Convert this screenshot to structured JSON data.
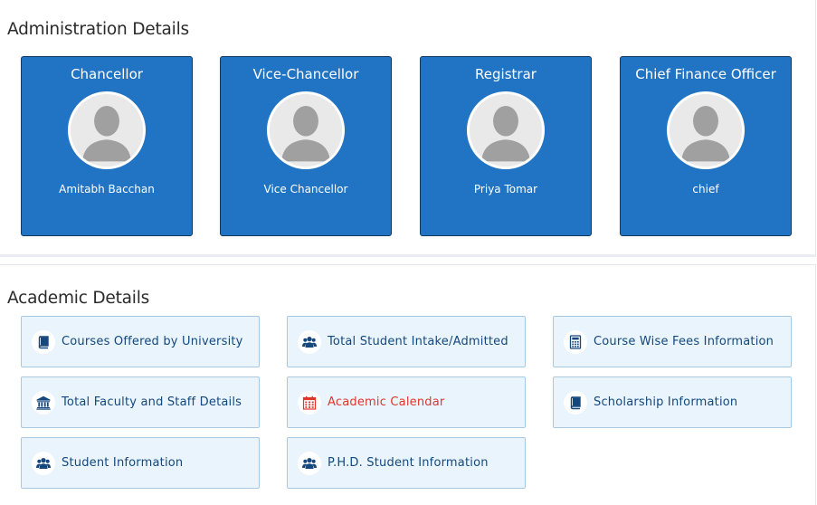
{
  "admin": {
    "title": "Administration Details",
    "cards": [
      {
        "role": "Chancellor",
        "name": "Amitabh Bacchan"
      },
      {
        "role": "Vice-Chancellor",
        "name": "Vice Chancellor"
      },
      {
        "role": "Registrar",
        "name": "Priya Tomar"
      },
      {
        "role": "Chief Finance Officer",
        "name": "chief"
      }
    ]
  },
  "academic": {
    "title": "Academic Details",
    "links": [
      {
        "label": "Courses Offered by University",
        "icon": "book-icon"
      },
      {
        "label": "Total Student Intake/Admitted",
        "icon": "users-icon"
      },
      {
        "label": "Course Wise Fees Information",
        "icon": "calculator-icon"
      },
      {
        "label": "Total Faculty and Staff Details",
        "icon": "institution-icon"
      },
      {
        "label": "Academic Calendar",
        "icon": "calendar-icon",
        "color": "#e0362c"
      },
      {
        "label": "Scholarship Information",
        "icon": "book-icon"
      },
      {
        "label": "Student Information",
        "icon": "users-icon"
      },
      {
        "label": "P.H.D. Student Information",
        "icon": "users-icon"
      }
    ]
  },
  "colors": {
    "card_bg": "#2174c3",
    "tile_bg": "#e9f4fd",
    "link_text": "#14487d",
    "highlight_text": "#e0362c"
  }
}
